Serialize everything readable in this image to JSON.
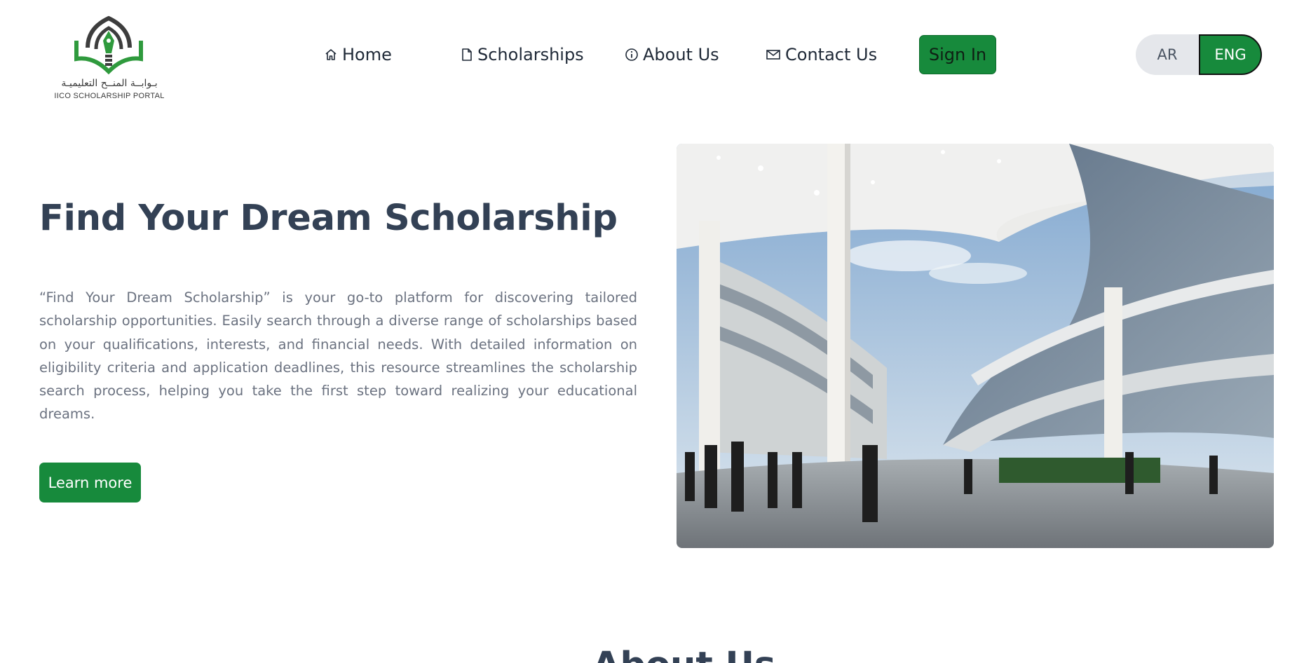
{
  "brand": {
    "logo_text_ar": "بـوابــة المنــح التعليميـة",
    "logo_text_en": "IICO SCHOLARSHIP PORTAL",
    "logo_icon": "pen-book-dome-logo"
  },
  "nav": {
    "items": [
      {
        "label": "Home",
        "icon": "home-icon"
      },
      {
        "label": "Scholarships",
        "icon": "document-icon"
      },
      {
        "label": "About Us",
        "icon": "info-icon"
      },
      {
        "label": "Contact Us",
        "icon": "mail-icon"
      }
    ],
    "signin_label": "Sign In"
  },
  "language": {
    "ar_label": "AR",
    "en_label": "ENG",
    "active": "ENG"
  },
  "hero": {
    "title": "Find Your Dream Scholarship",
    "description": "“Find Your Dream Scholarship” is your go-to platform for discovering tailored scholarship opportunities. Easily search through a diverse range of scholarships based on your qualifications, interests, and financial needs. With detailed information on eligibility criteria and application deadlines, this resource streamlines the scholarship search process, helping you take the first step toward realizing your educational dreams.",
    "cta_label": "Learn more"
  },
  "about": {
    "heading": "About Us"
  },
  "colors": {
    "brand_green": "#178a3c",
    "heading": "#334155",
    "body_text": "#6b7280"
  }
}
